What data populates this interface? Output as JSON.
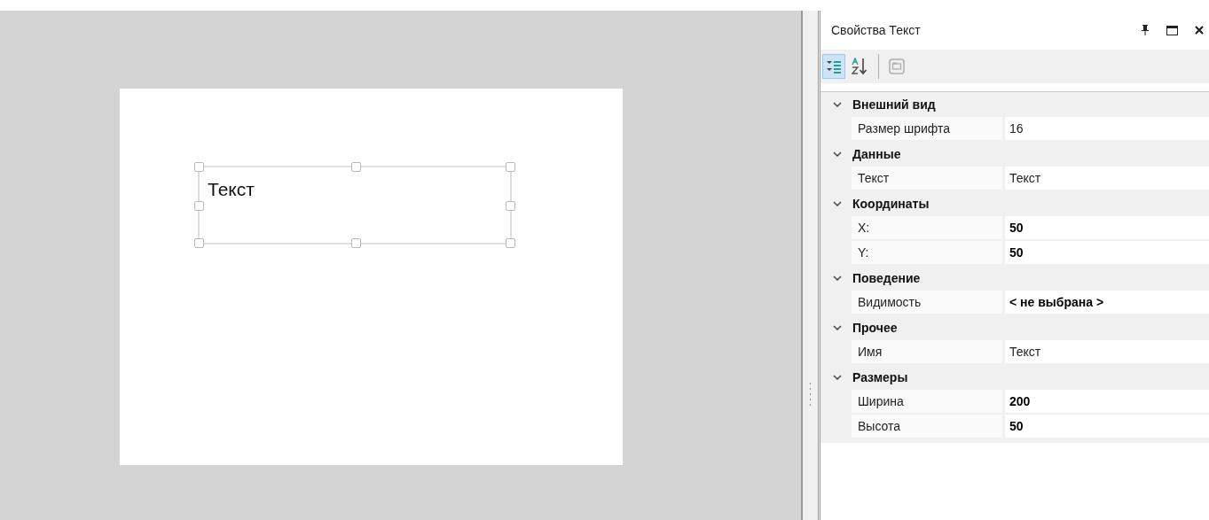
{
  "designer": {
    "canvas": {
      "elements": [
        {
          "kind": "text",
          "text": "Текст",
          "selected": true
        }
      ]
    }
  },
  "properties_panel": {
    "title": "Свойства Текст",
    "toolbar": [
      {
        "kind": "categorized",
        "selected": true,
        "disabled": false
      },
      {
        "kind": "alphabetical",
        "selected": false,
        "disabled": false
      },
      {
        "kind": "pages",
        "selected": false,
        "disabled": true
      }
    ],
    "categories": [
      {
        "name": "Внешний вид",
        "expanded": true,
        "properties": [
          {
            "name": "Размер шрифта",
            "value": "16",
            "modified": false
          }
        ]
      },
      {
        "name": "Данные",
        "expanded": true,
        "properties": [
          {
            "name": "Текст",
            "value": "Текст",
            "modified": false
          }
        ]
      },
      {
        "name": "Координаты",
        "expanded": true,
        "properties": [
          {
            "name": "X:",
            "value": "50",
            "modified": true
          },
          {
            "name": "Y:",
            "value": "50",
            "modified": true
          }
        ]
      },
      {
        "name": "Поведение",
        "expanded": true,
        "properties": [
          {
            "name": "Видимость",
            "value": "< не выбрана >",
            "modified": true
          }
        ]
      },
      {
        "name": "Прочее",
        "expanded": true,
        "properties": [
          {
            "name": "Имя",
            "value": "Текст",
            "modified": false
          }
        ]
      },
      {
        "name": "Размеры",
        "expanded": true,
        "properties": [
          {
            "name": "Ширина",
            "value": "200",
            "modified": true
          },
          {
            "name": "Высота",
            "value": "50",
            "modified": true
          }
        ]
      }
    ]
  }
}
